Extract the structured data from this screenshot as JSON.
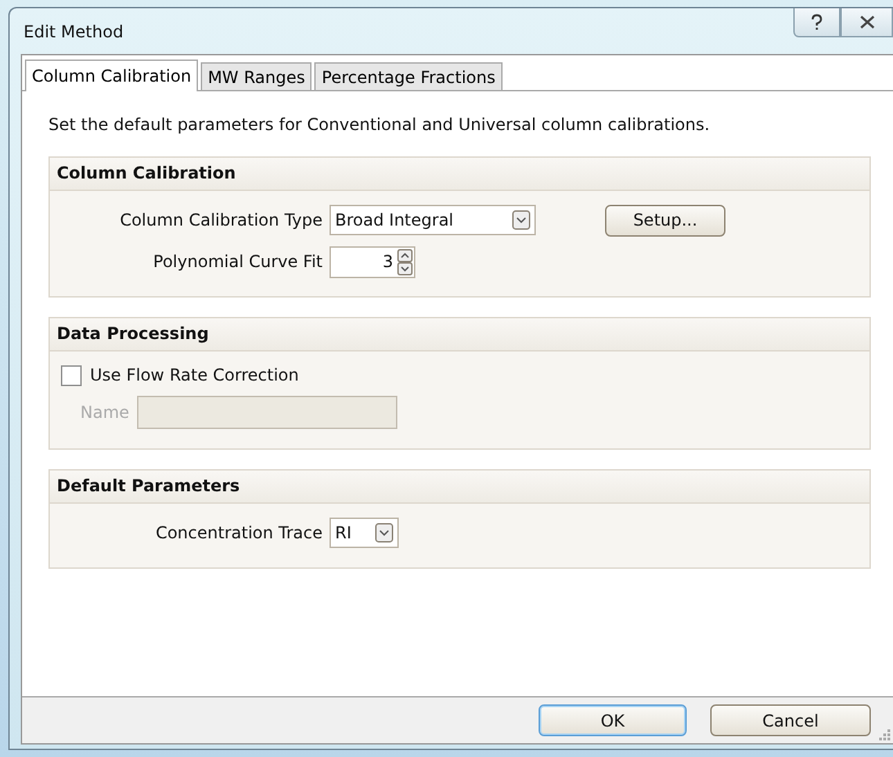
{
  "window": {
    "title": "Edit Method"
  },
  "tabs": [
    {
      "label": "Column Calibration",
      "selected": true
    },
    {
      "label": "MW Ranges",
      "selected": false
    },
    {
      "label": "Percentage Fractions",
      "selected": false
    }
  ],
  "description": "Set the default parameters for Conventional and Universal column calibrations.",
  "groups": [
    {
      "title": "Column Calibration",
      "fields": [
        {
          "kind": "dropdown",
          "label": "Column Calibration Type",
          "value": "Broad Integral",
          "button": "Setup..."
        },
        {
          "kind": "spinner",
          "label": "Polynomial Curve Fit",
          "value": "3"
        }
      ]
    },
    {
      "title": "Data Processing",
      "fields": [
        {
          "kind": "checkbox",
          "label": "Use Flow Rate Correction",
          "checked": false
        },
        {
          "kind": "text",
          "label": "Name",
          "disabled": true
        }
      ]
    },
    {
      "title": "Default Parameters",
      "fields": [
        {
          "kind": "dropdown",
          "label": "Concentration Trace",
          "value": "RI"
        }
      ]
    }
  ],
  "buttons": [
    {
      "label": "OK",
      "default": true
    },
    {
      "label": "Cancel",
      "default": false
    }
  ]
}
